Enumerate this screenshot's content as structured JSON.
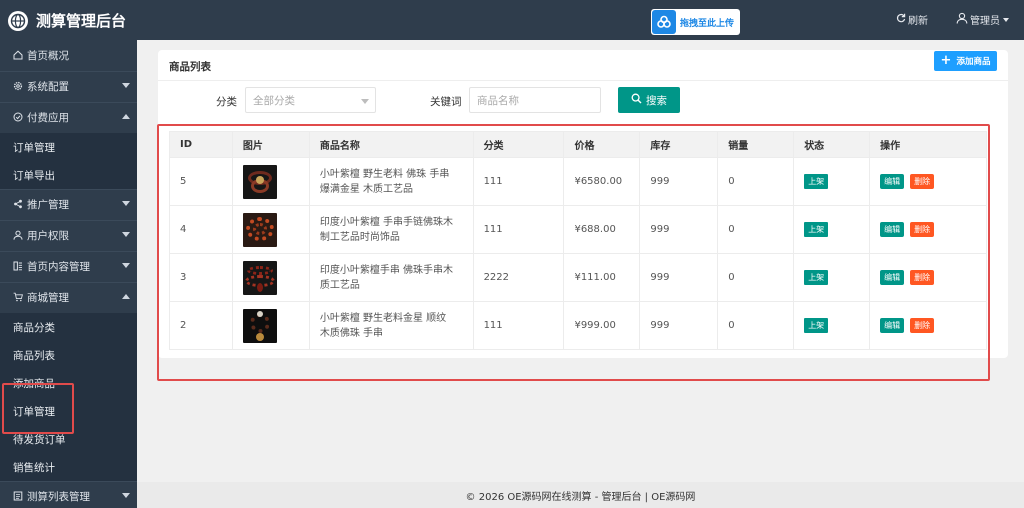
{
  "app": {
    "title": "测算管理后台"
  },
  "header": {
    "upload_label": "拖拽至此上传",
    "refresh_label": "刷新",
    "admin_label": "管理员"
  },
  "sidebar": {
    "items": [
      {
        "label": "首页概况",
        "icon": "home-icon"
      },
      {
        "label": "系统配置",
        "icon": "gear-icon",
        "state": "collapsed"
      },
      {
        "label": "付费应用",
        "icon": "pay-icon",
        "state": "expanded"
      },
      {
        "label": "订单管理"
      },
      {
        "label": "订单导出"
      },
      {
        "label": "推广管理",
        "icon": "share-icon",
        "state": "collapsed"
      },
      {
        "label": "用户权限",
        "icon": "user-icon",
        "state": "collapsed"
      },
      {
        "label": "首页内容管理",
        "icon": "layout-icon",
        "state": "collapsed"
      },
      {
        "label": "商城管理",
        "icon": "cart-icon",
        "state": "expanded"
      },
      {
        "label": "商品分类"
      },
      {
        "label": "商品列表"
      },
      {
        "label": "添加商品"
      },
      {
        "label": "订单管理"
      },
      {
        "label": "待发货订单"
      },
      {
        "label": "销售统计"
      },
      {
        "label": "测算列表管理",
        "icon": "list-icon",
        "state": "collapsed"
      }
    ]
  },
  "main": {
    "title": "商品列表",
    "add_button": "添加商品",
    "filters": {
      "category_label": "分类",
      "category_value": "全部分类",
      "keyword_label": "关键词",
      "keyword_placeholder": "商品名称",
      "search_button": "搜索"
    },
    "table": {
      "headers": [
        "ID",
        "图片",
        "商品名称",
        "分类",
        "价格",
        "库存",
        "销量",
        "状态",
        "操作"
      ],
      "rows": [
        {
          "id": "5",
          "name": "小叶紫檀 野生老料 佛珠 手串 爆满金星 木质工艺品",
          "category": "111",
          "price": "¥6580.00",
          "stock": "999",
          "sales": "0",
          "status": "上架"
        },
        {
          "id": "4",
          "name": "印度小叶紫檀 手串手链佛珠木制工艺品时尚饰品",
          "category": "111",
          "price": "¥688.00",
          "stock": "999",
          "sales": "0",
          "status": "上架"
        },
        {
          "id": "3",
          "name": "印度小叶紫檀手串 佛珠手串木质工艺品",
          "category": "2222",
          "price": "¥111.00",
          "stock": "999",
          "sales": "0",
          "status": "上架"
        },
        {
          "id": "2",
          "name": "小叶紫檀 野生老料金星 顺纹 木质佛珠 手串",
          "category": "111",
          "price": "¥999.00",
          "stock": "999",
          "sales": "0",
          "status": "上架"
        }
      ],
      "edit_label": "编辑",
      "delete_label": "删除"
    }
  },
  "footer": {
    "text": "© 2026 OE源码网在线测算 - 管理后台 | OE源码网"
  },
  "colors": {
    "nav_bg": "#2f3d4c",
    "primary": "#009688",
    "blue": "#1e9fff",
    "danger": "#ff5722",
    "highlight": "#e14b4b"
  }
}
